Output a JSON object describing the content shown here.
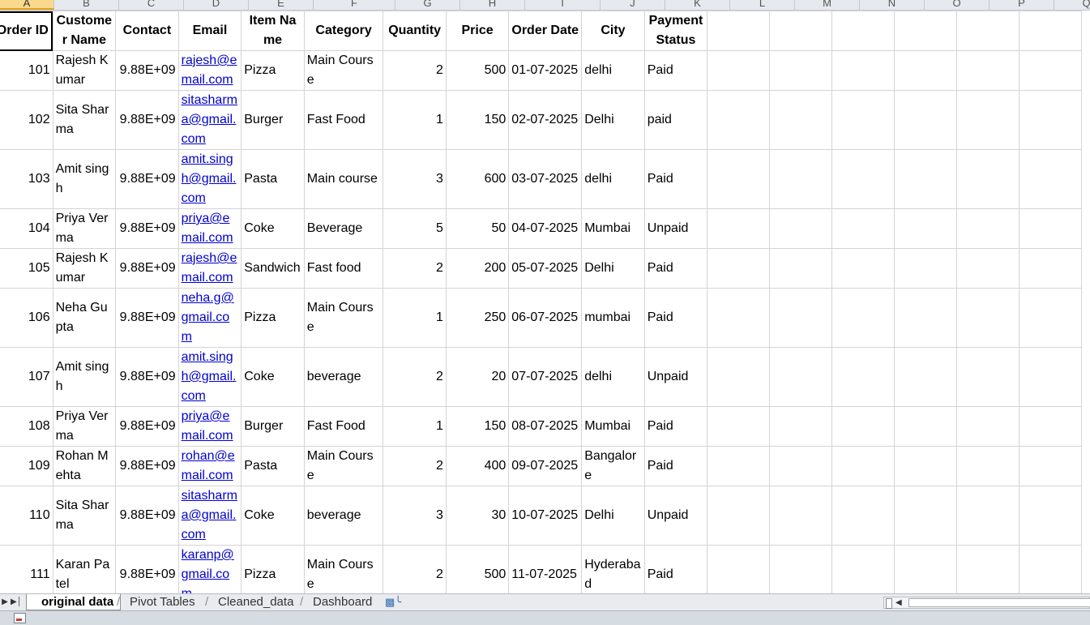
{
  "columns": [
    "A",
    "B",
    "C",
    "D",
    "E",
    "F",
    "G",
    "H",
    "I",
    "J",
    "K",
    "L",
    "M",
    "N",
    "O",
    "P",
    "Q"
  ],
  "headers": [
    "Order ID",
    "Customer Name",
    "Contact",
    "Email",
    "Item Name",
    "Category",
    "Quantity",
    "Price",
    "Order Date",
    "City",
    "Payment Status"
  ],
  "rows": [
    {
      "id": "101",
      "name": "Rajesh Kumar",
      "contact": "9.88E+09",
      "email": "rajesh@email.com",
      "item": "Pizza",
      "category": "Main Course",
      "qty": "2",
      "price": "500",
      "date": "01-07-2025",
      "city": "delhi",
      "status": "Paid"
    },
    {
      "id": "102",
      "name": "Sita Sharma",
      "contact": "9.88E+09",
      "email": "sitasharma@gmail.com",
      "item": "Burger",
      "category": "Fast Food",
      "qty": "1",
      "price": "150",
      "date": "02-07-2025",
      "city": "Delhi",
      "status": "paid"
    },
    {
      "id": "103",
      "name": "Amit singh",
      "contact": "9.88E+09",
      "email": "amit.singh@gmail.com",
      "item": "Pasta",
      "category": "Main course",
      "qty": "3",
      "price": "600",
      "date": "03-07-2025",
      "city": "delhi",
      "status": "Paid"
    },
    {
      "id": "104",
      "name": "Priya Verma",
      "contact": "9.88E+09",
      "email": "priya@email.com",
      "item": "Coke",
      "category": "Beverage",
      "qty": "5",
      "price": "50",
      "date": "04-07-2025",
      "city": "Mumbai",
      "status": "Unpaid"
    },
    {
      "id": "105",
      "name": "Rajesh Kumar",
      "contact": "9.88E+09",
      "email": "rajesh@email.com",
      "item": "Sandwich",
      "category": "Fast food",
      "qty": "2",
      "price": "200",
      "date": "05-07-2025",
      "city": "Delhi",
      "status": "Paid"
    },
    {
      "id": "106",
      "name": "Neha Gupta",
      "contact": "9.88E+09",
      "email": "neha.g@gmail.com",
      "item": "Pizza",
      "category": "Main Course",
      "qty": "1",
      "price": "250",
      "date": "06-07-2025",
      "city": "mumbai",
      "status": "Paid"
    },
    {
      "id": "107",
      "name": "Amit singh",
      "contact": "9.88E+09",
      "email": "amit.singh@gmail.com",
      "item": "Coke",
      "category": "beverage",
      "qty": "2",
      "price": "20",
      "date": "07-07-2025",
      "city": "delhi",
      "status": "Unpaid"
    },
    {
      "id": "108",
      "name": "Priya Verma",
      "contact": "9.88E+09",
      "email": "priya@email.com",
      "item": "Burger",
      "category": "Fast Food",
      "qty": "1",
      "price": "150",
      "date": "08-07-2025",
      "city": "Mumbai",
      "status": "Paid"
    },
    {
      "id": "109",
      "name": "Rohan Mehta",
      "contact": "9.88E+09",
      "email": "rohan@email.com",
      "item": "Pasta",
      "category": "Main Course",
      "qty": "2",
      "price": "400",
      "date": "09-07-2025",
      "city": "Bangalore",
      "status": "Paid"
    },
    {
      "id": "110",
      "name": "Sita Sharma",
      "contact": "9.88E+09",
      "email": "sitasharma@gmail.com",
      "item": "Coke",
      "category": "beverage",
      "qty": "3",
      "price": "30",
      "date": "10-07-2025",
      "city": "Delhi",
      "status": "Unpaid"
    },
    {
      "id": "111",
      "name": "Karan Patel",
      "contact": "9.88E+09",
      "email": "karanp@gmail.com",
      "item": "Pizza",
      "category": "Main Course",
      "qty": "2",
      "price": "500",
      "date": "11-07-2025",
      "city": "Hyderabad",
      "status": "Paid"
    }
  ],
  "sheet_tabs": [
    "original data",
    "Pivot Tables",
    "Cleaned_data",
    "Dashboard"
  ],
  "active_tab": "original data",
  "icons": {
    "insert_sheet": "insert-sheet-icon",
    "macro": "macro-record-icon"
  },
  "colors": {
    "link": "#0000d0",
    "selected_column": "#f9d98b",
    "grid": "#d4d4d4"
  }
}
